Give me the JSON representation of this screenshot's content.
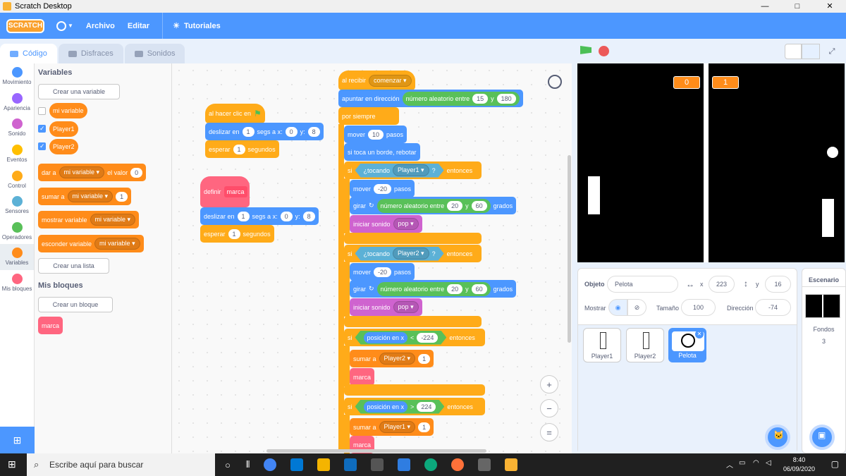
{
  "window": {
    "title": "Scratch Desktop",
    "min": "—",
    "max": "□",
    "close": "✕"
  },
  "menu": {
    "logo": "SCRATCH",
    "file": "Archivo",
    "edit": "Editar",
    "tutorials": "Tutoriales"
  },
  "tabs": [
    "Código",
    "Disfraces",
    "Sonidos"
  ],
  "categories": [
    "Movimiento",
    "Apariencia",
    "Sonido",
    "Eventos",
    "Control",
    "Sensores",
    "Operadores",
    "Variables",
    "Mis bloques"
  ],
  "category_colors": [
    "#4c97ff",
    "#9966ff",
    "#cf63cf",
    "#ffbf00",
    "#ffab19",
    "#5cb1d6",
    "#59c059",
    "#ff8c1a",
    "#ff6680"
  ],
  "palette": {
    "variables_title": "Variables",
    "make_var": "Crear una variable",
    "vars": [
      "mi variable",
      "Player1",
      "Player2"
    ],
    "set": {
      "label": "dar a",
      "var": "mi variable",
      "text": "el valor",
      "val": "0"
    },
    "change": {
      "label": "sumar a",
      "var": "mi variable",
      "val": "1"
    },
    "show": {
      "label": "mostrar variable",
      "var": "mi variable"
    },
    "hide": {
      "label": "esconder variable",
      "var": "mi variable"
    },
    "make_list": "Crear una lista",
    "myblocks_title": "Mis bloques",
    "make_block": "Crear un bloque",
    "custom": "marca"
  },
  "script1": {
    "hat": "al hacer clic en",
    "glide": "deslizar en",
    "secs": "segs a x:",
    "y": "y:",
    "t": "1",
    "x": "0",
    "yv": "8",
    "wait": "esperar",
    "wt": "1",
    "seconds": "segundos"
  },
  "script2": {
    "define": "definir",
    "name": "marca",
    "glide": "deslizar en",
    "secs": "segs a x:",
    "y": "y:",
    "t": "1",
    "x": "0",
    "yv": "8",
    "wait": "esperar",
    "wt": "1",
    "seconds": "segundos"
  },
  "script3": {
    "hat": "al recibir",
    "msg": "comenzar",
    "point": "apuntar en dirección",
    "rand": "número aleatorio entre",
    "r1": "15",
    "and": "y",
    "r2": "180",
    "forever": "por siempre",
    "move": "mover",
    "steps": "10",
    "pasos": "pasos",
    "bounce": "si toca un borde, rebotar",
    "if": "si",
    "touching": "¿tocando",
    "p1": "Player1",
    "p2": "Player2",
    "q": "?",
    "then": "entonces",
    "mv": "-20",
    "turn": "girar",
    "ra": "20",
    "rb": "60",
    "degrees": "grados",
    "sound": "iniciar sonido",
    "pop": "pop",
    "posx": "posición en x",
    "lt": "<",
    "gt": ">",
    "n1": "-224",
    "n2": "224",
    "add": "sumar a",
    "one": "1",
    "mark": "marca"
  },
  "stage": {
    "score1": "0",
    "score2": "1"
  },
  "sprite": {
    "object": "Objeto",
    "name": "Pelota",
    "x_label": "x",
    "x": "223",
    "y_label": "y",
    "y": "16",
    "show": "Mostrar",
    "size_label": "Tamaño",
    "size": "100",
    "dir_label": "Dirección",
    "dir": "-74",
    "sprites": [
      "Player1",
      "Player2",
      "Pelota"
    ]
  },
  "backdrop": {
    "title": "Escenario",
    "label": "Fondos",
    "count": "3"
  },
  "taskbar": {
    "search": "Escribe aquí para buscar",
    "time": "8:40",
    "date": "06/09/2020"
  }
}
